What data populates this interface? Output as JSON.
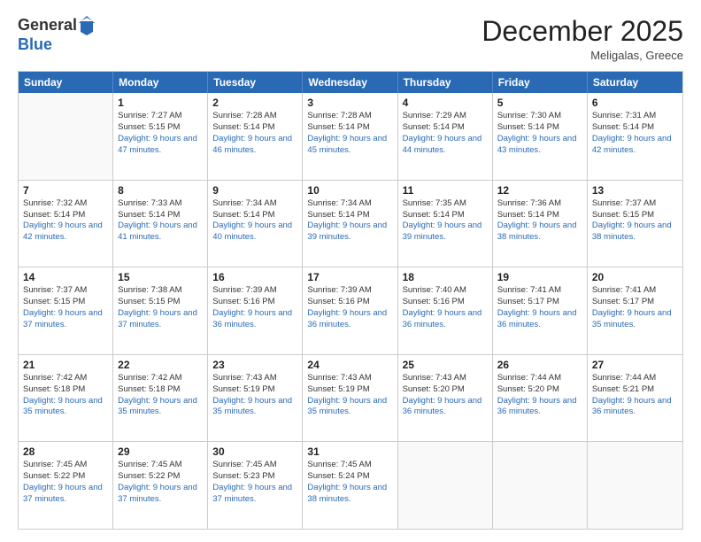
{
  "header": {
    "logo_line1": "General",
    "logo_line2": "Blue",
    "month_title": "December 2025",
    "location": "Meligalas, Greece"
  },
  "days_of_week": [
    "Sunday",
    "Monday",
    "Tuesday",
    "Wednesday",
    "Thursday",
    "Friday",
    "Saturday"
  ],
  "rows": [
    [
      {
        "day": "",
        "sunrise": "",
        "sunset": "",
        "daylight": ""
      },
      {
        "day": "1",
        "sunrise": "Sunrise: 7:27 AM",
        "sunset": "Sunset: 5:15 PM",
        "daylight": "Daylight: 9 hours and 47 minutes."
      },
      {
        "day": "2",
        "sunrise": "Sunrise: 7:28 AM",
        "sunset": "Sunset: 5:14 PM",
        "daylight": "Daylight: 9 hours and 46 minutes."
      },
      {
        "day": "3",
        "sunrise": "Sunrise: 7:28 AM",
        "sunset": "Sunset: 5:14 PM",
        "daylight": "Daylight: 9 hours and 45 minutes."
      },
      {
        "day": "4",
        "sunrise": "Sunrise: 7:29 AM",
        "sunset": "Sunset: 5:14 PM",
        "daylight": "Daylight: 9 hours and 44 minutes."
      },
      {
        "day": "5",
        "sunrise": "Sunrise: 7:30 AM",
        "sunset": "Sunset: 5:14 PM",
        "daylight": "Daylight: 9 hours and 43 minutes."
      },
      {
        "day": "6",
        "sunrise": "Sunrise: 7:31 AM",
        "sunset": "Sunset: 5:14 PM",
        "daylight": "Daylight: 9 hours and 42 minutes."
      }
    ],
    [
      {
        "day": "7",
        "sunrise": "Sunrise: 7:32 AM",
        "sunset": "Sunset: 5:14 PM",
        "daylight": "Daylight: 9 hours and 42 minutes."
      },
      {
        "day": "8",
        "sunrise": "Sunrise: 7:33 AM",
        "sunset": "Sunset: 5:14 PM",
        "daylight": "Daylight: 9 hours and 41 minutes."
      },
      {
        "day": "9",
        "sunrise": "Sunrise: 7:34 AM",
        "sunset": "Sunset: 5:14 PM",
        "daylight": "Daylight: 9 hours and 40 minutes."
      },
      {
        "day": "10",
        "sunrise": "Sunrise: 7:34 AM",
        "sunset": "Sunset: 5:14 PM",
        "daylight": "Daylight: 9 hours and 39 minutes."
      },
      {
        "day": "11",
        "sunrise": "Sunrise: 7:35 AM",
        "sunset": "Sunset: 5:14 PM",
        "daylight": "Daylight: 9 hours and 39 minutes."
      },
      {
        "day": "12",
        "sunrise": "Sunrise: 7:36 AM",
        "sunset": "Sunset: 5:14 PM",
        "daylight": "Daylight: 9 hours and 38 minutes."
      },
      {
        "day": "13",
        "sunrise": "Sunrise: 7:37 AM",
        "sunset": "Sunset: 5:15 PM",
        "daylight": "Daylight: 9 hours and 38 minutes."
      }
    ],
    [
      {
        "day": "14",
        "sunrise": "Sunrise: 7:37 AM",
        "sunset": "Sunset: 5:15 PM",
        "daylight": "Daylight: 9 hours and 37 minutes."
      },
      {
        "day": "15",
        "sunrise": "Sunrise: 7:38 AM",
        "sunset": "Sunset: 5:15 PM",
        "daylight": "Daylight: 9 hours and 37 minutes."
      },
      {
        "day": "16",
        "sunrise": "Sunrise: 7:39 AM",
        "sunset": "Sunset: 5:16 PM",
        "daylight": "Daylight: 9 hours and 36 minutes."
      },
      {
        "day": "17",
        "sunrise": "Sunrise: 7:39 AM",
        "sunset": "Sunset: 5:16 PM",
        "daylight": "Daylight: 9 hours and 36 minutes."
      },
      {
        "day": "18",
        "sunrise": "Sunrise: 7:40 AM",
        "sunset": "Sunset: 5:16 PM",
        "daylight": "Daylight: 9 hours and 36 minutes."
      },
      {
        "day": "19",
        "sunrise": "Sunrise: 7:41 AM",
        "sunset": "Sunset: 5:17 PM",
        "daylight": "Daylight: 9 hours and 36 minutes."
      },
      {
        "day": "20",
        "sunrise": "Sunrise: 7:41 AM",
        "sunset": "Sunset: 5:17 PM",
        "daylight": "Daylight: 9 hours and 35 minutes."
      }
    ],
    [
      {
        "day": "21",
        "sunrise": "Sunrise: 7:42 AM",
        "sunset": "Sunset: 5:18 PM",
        "daylight": "Daylight: 9 hours and 35 minutes."
      },
      {
        "day": "22",
        "sunrise": "Sunrise: 7:42 AM",
        "sunset": "Sunset: 5:18 PM",
        "daylight": "Daylight: 9 hours and 35 minutes."
      },
      {
        "day": "23",
        "sunrise": "Sunrise: 7:43 AM",
        "sunset": "Sunset: 5:19 PM",
        "daylight": "Daylight: 9 hours and 35 minutes."
      },
      {
        "day": "24",
        "sunrise": "Sunrise: 7:43 AM",
        "sunset": "Sunset: 5:19 PM",
        "daylight": "Daylight: 9 hours and 35 minutes."
      },
      {
        "day": "25",
        "sunrise": "Sunrise: 7:43 AM",
        "sunset": "Sunset: 5:20 PM",
        "daylight": "Daylight: 9 hours and 36 minutes."
      },
      {
        "day": "26",
        "sunrise": "Sunrise: 7:44 AM",
        "sunset": "Sunset: 5:20 PM",
        "daylight": "Daylight: 9 hours and 36 minutes."
      },
      {
        "day": "27",
        "sunrise": "Sunrise: 7:44 AM",
        "sunset": "Sunset: 5:21 PM",
        "daylight": "Daylight: 9 hours and 36 minutes."
      }
    ],
    [
      {
        "day": "28",
        "sunrise": "Sunrise: 7:45 AM",
        "sunset": "Sunset: 5:22 PM",
        "daylight": "Daylight: 9 hours and 37 minutes."
      },
      {
        "day": "29",
        "sunrise": "Sunrise: 7:45 AM",
        "sunset": "Sunset: 5:22 PM",
        "daylight": "Daylight: 9 hours and 37 minutes."
      },
      {
        "day": "30",
        "sunrise": "Sunrise: 7:45 AM",
        "sunset": "Sunset: 5:23 PM",
        "daylight": "Daylight: 9 hours and 37 minutes."
      },
      {
        "day": "31",
        "sunrise": "Sunrise: 7:45 AM",
        "sunset": "Sunset: 5:24 PM",
        "daylight": "Daylight: 9 hours and 38 minutes."
      },
      {
        "day": "",
        "sunrise": "",
        "sunset": "",
        "daylight": ""
      },
      {
        "day": "",
        "sunrise": "",
        "sunset": "",
        "daylight": ""
      },
      {
        "day": "",
        "sunrise": "",
        "sunset": "",
        "daylight": ""
      }
    ]
  ]
}
